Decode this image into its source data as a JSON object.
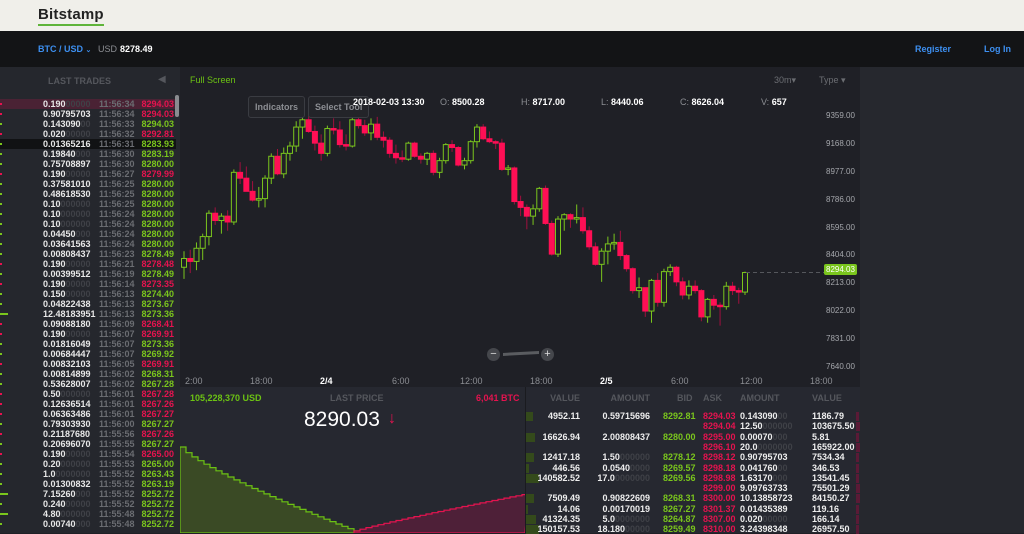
{
  "brand": "Bitstamp",
  "nav": {
    "pair": "BTC / USD",
    "currency": "USD",
    "price": "8278.49",
    "register": "Register",
    "login": "Log In"
  },
  "trades": {
    "title": "LAST TRADES",
    "rows": [
      {
        "amount": "0.190",
        "time": "11:56:34",
        "price": "8294.03",
        "side": "sell"
      },
      {
        "amount": "0.90795703",
        "time": "11:56:34",
        "price": "8294.03",
        "side": "sell"
      },
      {
        "amount": "0.143090",
        "time": "11:56:33",
        "price": "8294.03",
        "side": "buy"
      },
      {
        "amount": "0.020",
        "time": "11:56:32",
        "price": "8292.81",
        "side": "sell"
      },
      {
        "amount": "0.01365216",
        "time": "11:56:31",
        "price": "8283.93",
        "side": "buy"
      },
      {
        "amount": "0.19840",
        "time": "11:56:30",
        "price": "8283.19",
        "side": "buy"
      },
      {
        "amount": "0.75708897",
        "time": "11:56:30",
        "price": "8280.00",
        "side": "buy"
      },
      {
        "amount": "0.190",
        "time": "11:56:27",
        "price": "8279.99",
        "side": "sell"
      },
      {
        "amount": "0.37581010",
        "time": "11:56:25",
        "price": "8280.00",
        "side": "buy"
      },
      {
        "amount": "0.48618530",
        "time": "11:56:25",
        "price": "8280.00",
        "side": "buy"
      },
      {
        "amount": "0.10",
        "time": "11:56:25",
        "price": "8280.00",
        "side": "buy"
      },
      {
        "amount": "0.10",
        "time": "11:56:24",
        "price": "8280.00",
        "side": "buy"
      },
      {
        "amount": "0.10",
        "time": "11:56:24",
        "price": "8280.00",
        "side": "buy"
      },
      {
        "amount": "0.04450",
        "time": "11:56:24",
        "price": "8280.00",
        "side": "buy"
      },
      {
        "amount": "0.03641563",
        "time": "11:56:24",
        "price": "8280.00",
        "side": "buy"
      },
      {
        "amount": "0.00808437",
        "time": "11:56:23",
        "price": "8278.49",
        "side": "buy"
      },
      {
        "amount": "0.190",
        "time": "11:56:21",
        "price": "8278.48",
        "side": "sell"
      },
      {
        "amount": "0.00399512",
        "time": "11:56:19",
        "price": "8278.49",
        "side": "buy"
      },
      {
        "amount": "0.190",
        "time": "11:56:14",
        "price": "8273.35",
        "side": "sell"
      },
      {
        "amount": "0.150",
        "time": "11:56:13",
        "price": "8274.40",
        "side": "buy"
      },
      {
        "amount": "0.04822438",
        "time": "11:56:13",
        "price": "8273.67",
        "side": "buy"
      },
      {
        "amount": "12.48183951",
        "time": "11:56:13",
        "price": "8273.36",
        "side": "buy"
      },
      {
        "amount": "0.09088180",
        "time": "11:56:09",
        "price": "8268.41",
        "side": "sell"
      },
      {
        "amount": "0.190",
        "time": "11:56:07",
        "price": "8269.91",
        "side": "sell"
      },
      {
        "amount": "0.01816049",
        "time": "11:56:07",
        "price": "8273.36",
        "side": "buy"
      },
      {
        "amount": "0.00684447",
        "time": "11:56:07",
        "price": "8269.92",
        "side": "buy"
      },
      {
        "amount": "0.00832103",
        "time": "11:56:05",
        "price": "8269.91",
        "side": "sell"
      },
      {
        "amount": "0.00814899",
        "time": "11:56:02",
        "price": "8268.31",
        "side": "buy"
      },
      {
        "amount": "0.53628007",
        "time": "11:56:02",
        "price": "8267.28",
        "side": "buy"
      },
      {
        "amount": "0.50",
        "time": "11:56:01",
        "price": "8267.28",
        "side": "sell"
      },
      {
        "amount": "0.12636514",
        "time": "11:56:01",
        "price": "8267.26",
        "side": "sell"
      },
      {
        "amount": "0.06363486",
        "time": "11:56:01",
        "price": "8267.27",
        "side": "sell"
      },
      {
        "amount": "0.79303930",
        "time": "11:56:00",
        "price": "8267.27",
        "side": "buy"
      },
      {
        "amount": "0.21187680",
        "time": "11:55:56",
        "price": "8267.26",
        "side": "sell"
      },
      {
        "amount": "0.20696070",
        "time": "11:55:55",
        "price": "8267.27",
        "side": "buy"
      },
      {
        "amount": "0.190",
        "time": "11:55:54",
        "price": "8265.00",
        "side": "sell"
      },
      {
        "amount": "0.20",
        "time": "11:55:53",
        "price": "8265.00",
        "side": "buy"
      },
      {
        "amount": "1.0",
        "time": "11:55:52",
        "price": "8263.43",
        "side": "buy"
      },
      {
        "amount": "0.01300832",
        "time": "11:55:52",
        "price": "8263.19",
        "side": "buy"
      },
      {
        "amount": "7.15260",
        "time": "11:55:52",
        "price": "8252.72",
        "side": "buy"
      },
      {
        "amount": "0.240",
        "time": "11:55:52",
        "price": "8252.72",
        "side": "buy"
      },
      {
        "amount": "4.80",
        "time": "11:55:48",
        "price": "8252.72",
        "side": "buy"
      },
      {
        "amount": "0.00740",
        "time": "11:55:48",
        "price": "8252.72",
        "side": "buy"
      }
    ]
  },
  "chart": {
    "full_screen": "Full Screen",
    "indicators": "Indicators",
    "select_tool": "Select Tool",
    "interval": "30m",
    "type": "Type",
    "ohlc": {
      "t": "2018-02-03 13:30",
      "o_label": "O:",
      "o": "8500.28",
      "h_label": "H:",
      "h": "8717.00",
      "l_label": "L:",
      "l": "8440.06",
      "c_label": "C:",
      "c": "8626.04",
      "v_label": "V:",
      "v": "657"
    },
    "current_price": "8294.03"
  },
  "chart_data": {
    "type": "candlestick",
    "yticks": [
      "9359.00",
      "9168.00",
      "8977.00",
      "8786.00",
      "8595.00",
      "8404.00",
      "8213.00",
      "8022.00",
      "7831.00",
      "7640.00"
    ],
    "ylim": [
      7640,
      9359
    ],
    "xticks": [
      "2:00",
      "18:00",
      "2/4",
      "6:00",
      "12:00",
      "18:00",
      "2/5",
      "6:00",
      "12:00",
      "18:00"
    ],
    "colors": {
      "up": "#7ac51d",
      "down": "#ff0f55"
    },
    "candles": [
      [
        8330,
        8440,
        8250,
        8390
      ],
      [
        8390,
        8450,
        8290,
        8370
      ],
      [
        8370,
        8500,
        8310,
        8460
      ],
      [
        8460,
        8560,
        8380,
        8540
      ],
      [
        8540,
        8720,
        8480,
        8700
      ],
      [
        8700,
        8740,
        8620,
        8650
      ],
      [
        8650,
        8700,
        8560,
        8680
      ],
      [
        8680,
        8720,
        8580,
        8640
      ],
      [
        8640,
        9000,
        8620,
        8980
      ],
      [
        8980,
        9050,
        8900,
        8940
      ],
      [
        8940,
        9020,
        8860,
        8850
      ],
      [
        8850,
        8920,
        8780,
        8790
      ],
      [
        8790,
        8880,
        8740,
        8800
      ],
      [
        8800,
        8960,
        8740,
        8940
      ],
      [
        8940,
        9110,
        8900,
        9090
      ],
      [
        9090,
        9140,
        8960,
        8970
      ],
      [
        8970,
        9150,
        8940,
        9110
      ],
      [
        9110,
        9190,
        9060,
        9160
      ],
      [
        9160,
        9330,
        9120,
        9290
      ],
      [
        9290,
        9370,
        9210,
        9340
      ],
      [
        9340,
        9390,
        9250,
        9260
      ],
      [
        9260,
        9300,
        9130,
        9180
      ],
      [
        9180,
        9240,
        9060,
        9110
      ],
      [
        9110,
        9300,
        9090,
        9280
      ],
      [
        9280,
        9350,
        9240,
        9270
      ],
      [
        9270,
        9330,
        9150,
        9170
      ],
      [
        9170,
        9240,
        9130,
        9160
      ],
      [
        9160,
        9360,
        9150,
        9340
      ],
      [
        9340,
        9370,
        9280,
        9300
      ],
      [
        9300,
        9340,
        9230,
        9250
      ],
      [
        9250,
        9350,
        9200,
        9310
      ],
      [
        9310,
        9360,
        9200,
        9220
      ],
      [
        9220,
        9260,
        9150,
        9200
      ],
      [
        9200,
        9220,
        9080,
        9110
      ],
      [
        9110,
        9170,
        9040,
        9080
      ],
      [
        9080,
        9130,
        9050,
        9070
      ],
      [
        9070,
        9190,
        9060,
        9180
      ],
      [
        9180,
        9190,
        9080,
        9090
      ],
      [
        9090,
        9110,
        9040,
        9070
      ],
      [
        9070,
        9120,
        9030,
        9110
      ],
      [
        9110,
        9130,
        8960,
        8980
      ],
      [
        8980,
        9080,
        8940,
        9060
      ],
      [
        9060,
        9180,
        9040,
        9170
      ],
      [
        9170,
        9200,
        9120,
        9150
      ],
      [
        9150,
        9160,
        9020,
        9030
      ],
      [
        9030,
        9080,
        9000,
        9060
      ],
      [
        9060,
        9200,
        9040,
        9190
      ],
      [
        9190,
        9310,
        9150,
        9290
      ],
      [
        9290,
        9310,
        9200,
        9210
      ],
      [
        9210,
        9260,
        9180,
        9190
      ],
      [
        9190,
        9200,
        9140,
        9180
      ],
      [
        9180,
        9210,
        8990,
        9000
      ],
      [
        9000,
        9030,
        8960,
        9010
      ],
      [
        9010,
        9020,
        8760,
        8780
      ],
      [
        8780,
        8820,
        8680,
        8740
      ],
      [
        8740,
        8760,
        8590,
        8680
      ],
      [
        8680,
        8760,
        8620,
        8730
      ],
      [
        8730,
        8880,
        8710,
        8870
      ],
      [
        8870,
        8890,
        8620,
        8630
      ],
      [
        8630,
        8650,
        8410,
        8420
      ],
      [
        8420,
        8680,
        8400,
        8660
      ],
      [
        8660,
        8700,
        8580,
        8690
      ],
      [
        8690,
        8700,
        8600,
        8660
      ],
      [
        8660,
        8760,
        8630,
        8670
      ],
      [
        8670,
        8740,
        8560,
        8580
      ],
      [
        8580,
        8610,
        8450,
        8470
      ],
      [
        8470,
        8500,
        8340,
        8350
      ],
      [
        8350,
        8460,
        8230,
        8440
      ],
      [
        8440,
        8540,
        8350,
        8490
      ],
      [
        8490,
        8560,
        8450,
        8500
      ],
      [
        8500,
        8580,
        8380,
        8410
      ],
      [
        8410,
        8420,
        8300,
        8320
      ],
      [
        8320,
        8330,
        8150,
        8170
      ],
      [
        8170,
        8260,
        8120,
        8190
      ],
      [
        8190,
        8190,
        7990,
        8030
      ],
      [
        8030,
        8250,
        7950,
        8240
      ],
      [
        8240,
        8290,
        8060,
        8090
      ],
      [
        8090,
        8320,
        8060,
        8300
      ],
      [
        8300,
        8350,
        8270,
        8330
      ],
      [
        8330,
        8340,
        8200,
        8230
      ],
      [
        8230,
        8260,
        8110,
        8140
      ],
      [
        8140,
        8240,
        8110,
        8200
      ],
      [
        8200,
        8240,
        8150,
        8170
      ],
      [
        8170,
        8180,
        7960,
        7990
      ],
      [
        7990,
        8120,
        7950,
        8110
      ],
      [
        8110,
        8140,
        8040,
        8070
      ],
      [
        8070,
        8090,
        7930,
        8060
      ],
      [
        8060,
        8230,
        8040,
        8200
      ],
      [
        8200,
        8230,
        8140,
        8170
      ],
      [
        8170,
        8190,
        8080,
        8160
      ],
      [
        8160,
        8300,
        8140,
        8294
      ]
    ]
  },
  "summary": {
    "volume_usd": "105,228,370 USD",
    "last_price_label": "LAST PRICE",
    "last_price": "8290.03",
    "arrow": "↓",
    "volume_btc": "6,041 BTC"
  },
  "orderbook": {
    "headers": [
      "VALUE",
      "AMOUNT",
      "BID",
      "ASK",
      "AMOUNT",
      "VALUE"
    ],
    "rows": [
      [
        "4952.11",
        "0.59715696",
        "8292.81",
        "8294.03",
        "0.143090",
        "1186.79"
      ],
      [
        "",
        "",
        "",
        "8294.04",
        "12.50",
        "103675.50"
      ],
      [
        "16626.94",
        "2.00808437",
        "8280.00",
        "8295.00",
        "0.00070",
        "5.81"
      ],
      [
        "",
        "",
        "",
        "8296.10",
        "20.0",
        "165922.00"
      ],
      [
        "12417.18",
        "1.50",
        "8278.12",
        "8298.12",
        "0.90795703",
        "7534.34"
      ],
      [
        "446.56",
        "0.0540",
        "8269.57",
        "8298.18",
        "0.041760",
        "346.53"
      ],
      [
        "140582.52",
        "17.0",
        "8269.56",
        "8298.98",
        "1.63170",
        "13541.45"
      ],
      [
        "",
        "",
        "",
        "8299.00",
        "9.09763733",
        "75501.29"
      ],
      [
        "7509.49",
        "0.90822609",
        "8268.31",
        "8300.00",
        "10.13858723",
        "84150.27"
      ],
      [
        "14.06",
        "0.00170019",
        "8267.27",
        "8301.37",
        "0.01435389",
        "119.16"
      ],
      [
        "41324.35",
        "5.0",
        "8264.87",
        "8307.00",
        "0.020",
        "166.14"
      ],
      [
        "150157.53",
        "18.180",
        "8259.49",
        "8310.00",
        "3.24398348",
        "26957.50"
      ]
    ]
  }
}
